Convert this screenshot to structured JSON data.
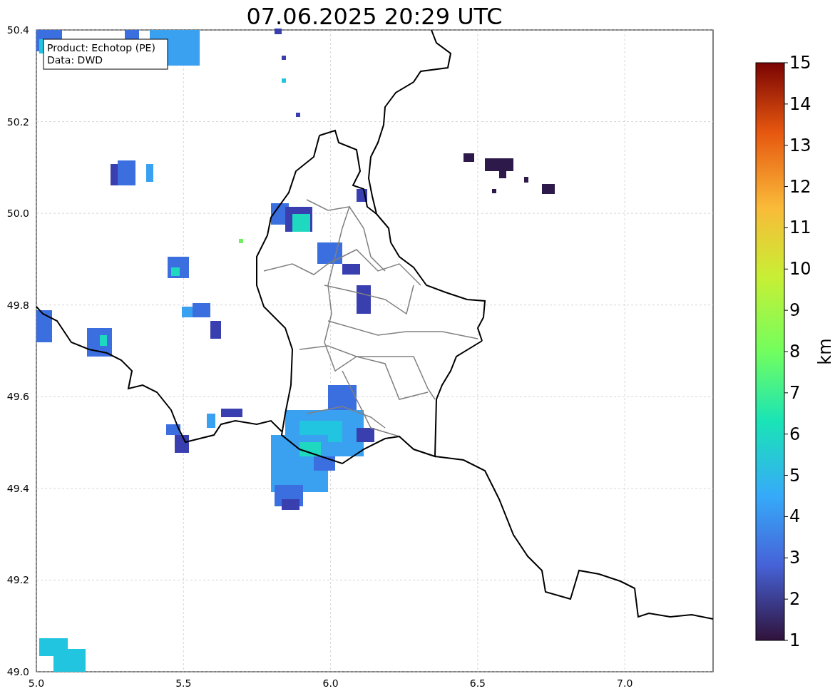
{
  "title": "07.06.2025 20:29 UTC",
  "info_box": [
    "Product: Echotop (PE)",
    "Data: DWD"
  ],
  "map": {
    "x_ticks": [
      "5.0",
      "5.5",
      "6.0",
      "6.5",
      "7.0"
    ],
    "y_ticks": [
      "50.4",
      "50.2",
      "50.0",
      "49.8",
      "49.6",
      "49.4",
      "49.2",
      "49.0"
    ]
  },
  "colorbar": {
    "ticks": [
      "15",
      "14",
      "13",
      "12",
      "11",
      "10",
      "9",
      "8",
      "7",
      "6",
      "5",
      "4",
      "3",
      "2",
      "1"
    ],
    "label": "km"
  }
}
